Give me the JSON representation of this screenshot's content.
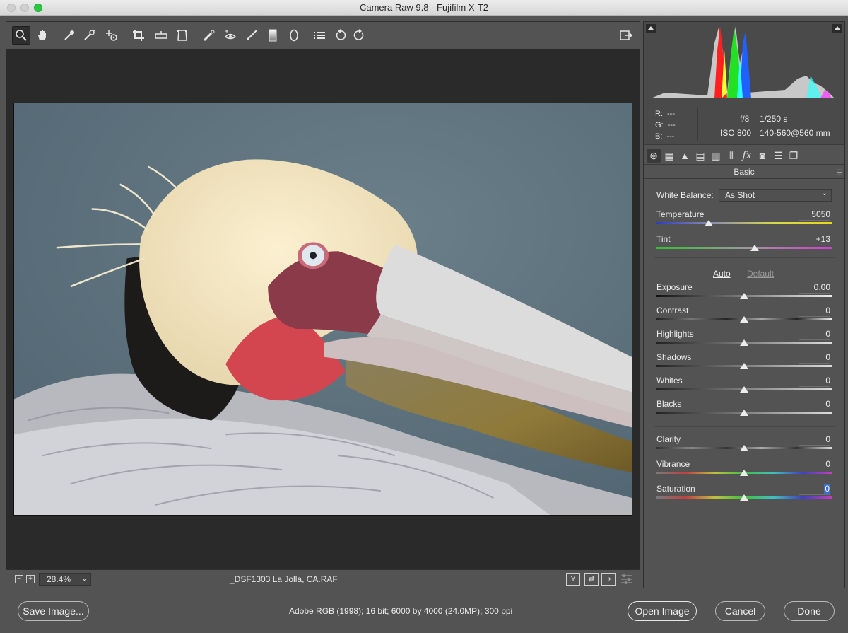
{
  "window": {
    "title": "Camera Raw 9.8  -  Fujifilm X-T2"
  },
  "toolbar": {
    "tools": [
      "zoom-tool",
      "hand-tool",
      "white-balance-tool",
      "color-sampler-tool",
      "targeted-adjustment-tool",
      "crop-tool",
      "straighten-tool",
      "transform-tool",
      "spot-removal-tool",
      "red-eye-removal-tool",
      "adjustment-brush",
      "graduated-filter",
      "radial-filter",
      "open-preferences",
      "rotate-left",
      "rotate-right"
    ]
  },
  "status": {
    "zoom": "28.4%",
    "filename": "_DSF1303 La Jolla, CA.RAF",
    "zoom_out": "−",
    "zoom_in": "+",
    "view_buttons": [
      "Y",
      "⇄",
      "⇥"
    ]
  },
  "readout": {
    "r": "R:",
    "r_val": "---",
    "g": "G:",
    "g_val": "---",
    "b": "B:",
    "b_val": "---",
    "aperture": "f/8",
    "shutter": "1/250 s",
    "iso": "ISO 800",
    "lens": "140-560@560 mm"
  },
  "panel": {
    "title": "Basic",
    "white_balance_label": "White Balance:",
    "white_balance_value": "As Shot",
    "auto": "Auto",
    "default": "Default",
    "sliders": [
      {
        "label": "Temperature",
        "value": "5050",
        "pos": 0.3
      },
      {
        "label": "Tint",
        "value": "+13",
        "pos": 0.56
      },
      {
        "label": "Exposure",
        "value": "0.00",
        "pos": 0.5
      },
      {
        "label": "Contrast",
        "value": "0",
        "pos": 0.5
      },
      {
        "label": "Highlights",
        "value": "0",
        "pos": 0.5
      },
      {
        "label": "Shadows",
        "value": "0",
        "pos": 0.5
      },
      {
        "label": "Whites",
        "value": "0",
        "pos": 0.5
      },
      {
        "label": "Blacks",
        "value": "0",
        "pos": 0.5
      },
      {
        "label": "Clarity",
        "value": "0",
        "pos": 0.5
      },
      {
        "label": "Vibrance",
        "value": "0",
        "pos": 0.5
      },
      {
        "label": "Saturation",
        "value": "0",
        "pos": 0.5
      }
    ]
  },
  "footer": {
    "save": "Save Image...",
    "info": "Adobe RGB (1998); 16 bit; 6000 by 4000 (24.0MP); 300 ppi",
    "open": "Open Image",
    "cancel": "Cancel",
    "done": "Done"
  },
  "colors": {
    "accent": "#3b6fd3",
    "panel": "#535353",
    "canvas": "#2a2a2a"
  }
}
